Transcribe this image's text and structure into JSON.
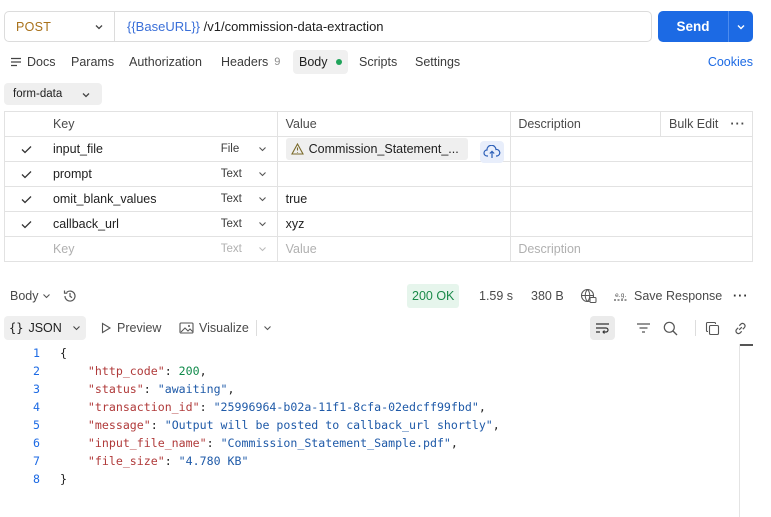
{
  "request": {
    "method": "POST",
    "url_variable": "{{BaseURL}}",
    "url_path": " /v1/commission-data-extraction",
    "send_label": "Send"
  },
  "tabs": {
    "docs": "Docs",
    "params": "Params",
    "authorization": "Authorization",
    "headers": "Headers",
    "headers_count": "9",
    "body": "Body",
    "scripts": "Scripts",
    "settings": "Settings",
    "cookies": "Cookies"
  },
  "body_mode": "form-data",
  "params_table": {
    "headers": {
      "key": "Key",
      "value": "Value",
      "description": "Description",
      "bulk_edit": "Bulk Edit"
    },
    "rows": [
      {
        "key": "input_file",
        "type": "File",
        "value": "Commission_Statement_...",
        "checked": true
      },
      {
        "key": "prompt",
        "type": "Text",
        "value": "",
        "checked": true
      },
      {
        "key": "omit_blank_values",
        "type": "Text",
        "value": "true",
        "checked": true
      },
      {
        "key": "callback_url",
        "type": "Text",
        "value": "xyz",
        "checked": true
      }
    ],
    "placeholder": {
      "key": "Key",
      "type": "Text",
      "value": "Value",
      "description": "Description"
    }
  },
  "response": {
    "body_label": "Body",
    "status": "200 OK",
    "time": "1.59 s",
    "size": "380 B",
    "save_label": "Save Response",
    "format": "JSON",
    "preview_label": "Preview",
    "visualize_label": "Visualize",
    "lines": [
      {
        "n": "1",
        "indent": "",
        "key": "",
        "value": "{",
        "vtype": "punct",
        "tail": ""
      },
      {
        "n": "2",
        "indent": "    ",
        "key": "\"http_code\"",
        "value": "200",
        "vtype": "num",
        "tail": ","
      },
      {
        "n": "3",
        "indent": "    ",
        "key": "\"status\"",
        "value": "\"awaiting\"",
        "vtype": "str",
        "tail": ","
      },
      {
        "n": "4",
        "indent": "    ",
        "key": "\"transaction_id\"",
        "value": "\"25996964-b02a-11f1-8cfa-02edcff99fbd\"",
        "vtype": "str",
        "tail": ","
      },
      {
        "n": "5",
        "indent": "    ",
        "key": "\"message\"",
        "value": "\"Output will be posted to callback_url shortly\"",
        "vtype": "str",
        "tail": ","
      },
      {
        "n": "6",
        "indent": "    ",
        "key": "\"input_file_name\"",
        "value": "\"Commission_Statement_Sample.pdf\"",
        "vtype": "str",
        "tail": ","
      },
      {
        "n": "7",
        "indent": "    ",
        "key": "\"file_size\"",
        "value": "\"4.780 KB\"",
        "vtype": "str",
        "tail": ""
      },
      {
        "n": "8",
        "indent": "",
        "key": "",
        "value": "}",
        "vtype": "punct",
        "tail": ""
      }
    ]
  },
  "colors": {
    "accent": "#1c6ae4",
    "method": "#a9711a",
    "ok": "#1a8a49",
    "json_key": "#b03a3a",
    "json_string": "#1f5aa8",
    "json_number": "#0f8a4a"
  }
}
